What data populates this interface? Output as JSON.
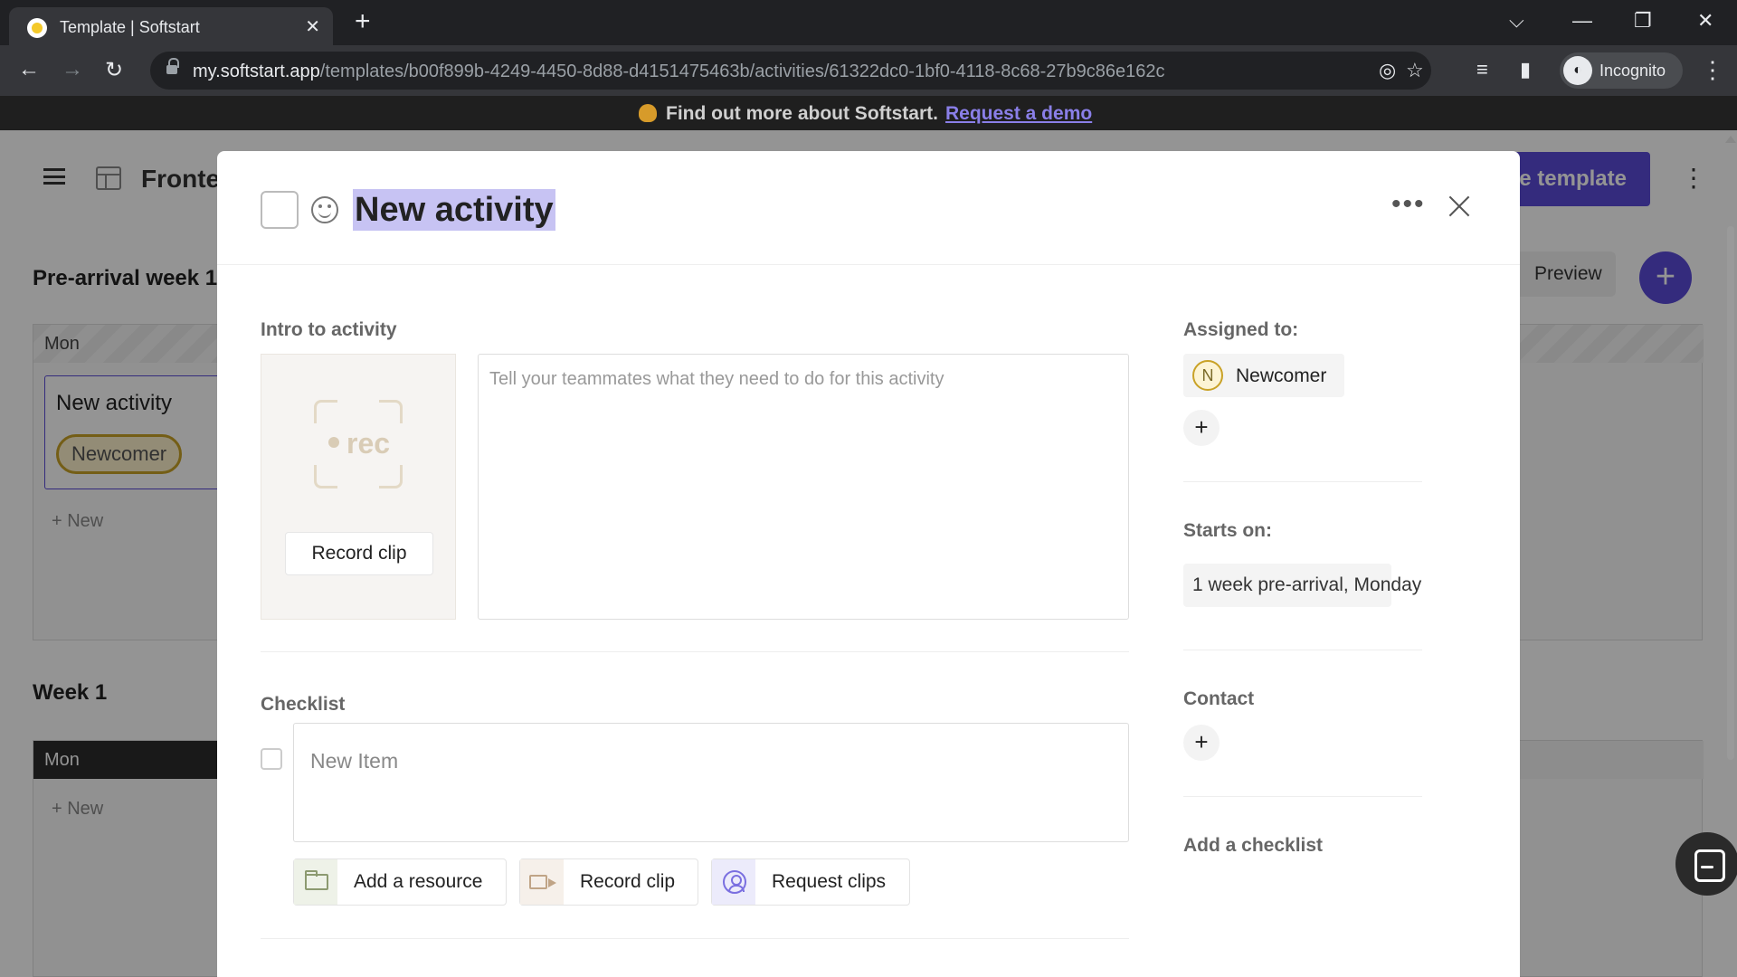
{
  "browser": {
    "tab_title": "Template | Softstart",
    "tab_close": "✕",
    "new_tab": "+",
    "url_host": "my.softstart.app",
    "url_path": "/templates/b00f899b-4249-4450-8d88-d4151475463b/activities/61322dc0-1bf0-4118-8c68-27b9c86e162c",
    "profile_label": "Incognito",
    "window_controls": {
      "tab_search": "⌵",
      "minimize": "—",
      "restore": "❐",
      "close": "✕"
    },
    "nav": {
      "back": "←",
      "forward": "→",
      "reload": "↻"
    },
    "icons": {
      "eye_off": "◎",
      "star": "☆",
      "media": "≡",
      "sidepanel": "▮",
      "menu": "⋮"
    }
  },
  "banner": {
    "text": "Find out more about Softstart.",
    "link": "Request a demo"
  },
  "app": {
    "title": "Fronte",
    "save_button": "e template",
    "more": "⋮",
    "preview_button": "Preview",
    "preview_icon": "◈",
    "add_button": "+",
    "sections": [
      {
        "title": "Pre-arrival week 1",
        "day": "Mon",
        "card_title": "New activity",
        "card_chip": "Newcomer",
        "new_label": "+ New"
      },
      {
        "title": "Week 1",
        "day": "Mon",
        "new_label": "+ New"
      }
    ]
  },
  "modal": {
    "title": "New activity",
    "more": "•••",
    "intro": {
      "label": "Intro to activity",
      "rec_text": "rec",
      "record_button": "Record clip",
      "placeholder": "Tell your teammates what they need to do for this activity"
    },
    "checklist": {
      "label": "Checklist",
      "placeholder": "New Item",
      "actions": [
        {
          "label": "Add a resource",
          "icon": "folder-icon",
          "color": "#eef2e8"
        },
        {
          "label": "Record clip",
          "icon": "camera-icon",
          "color": "#f6f0ea"
        },
        {
          "label": "Request clips",
          "icon": "person-icon",
          "color": "#ecebfb"
        }
      ]
    },
    "sidebar": {
      "assigned_label": "Assigned to:",
      "assignee_initial": "N",
      "assignee_name": "Newcomer",
      "add": "+",
      "starts_label": "Starts on:",
      "starts_value": "1 week pre-arrival, Monday",
      "contact_label": "Contact",
      "add_checklist": "Add a checklist"
    }
  },
  "colors": {
    "accent": "#5b4ad8",
    "title_highlight": "#c7c3f3",
    "newcomer_chip": "#c9a227"
  }
}
